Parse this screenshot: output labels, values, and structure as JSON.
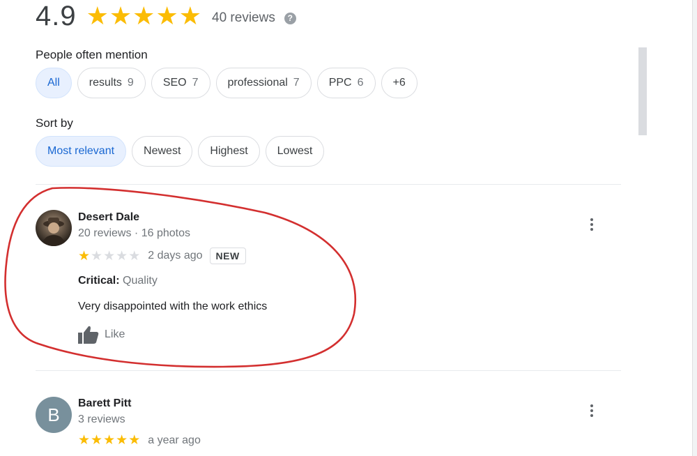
{
  "summary": {
    "rating": "4.9",
    "stars": 5,
    "review_count": "40 reviews",
    "help_icon": "question-mark-icon"
  },
  "mentions": {
    "label": "People often mention",
    "chips": [
      {
        "label": "All",
        "count": "",
        "selected": true
      },
      {
        "label": "results",
        "count": "9",
        "selected": false
      },
      {
        "label": "SEO",
        "count": "7",
        "selected": false
      },
      {
        "label": "professional",
        "count": "7",
        "selected": false
      },
      {
        "label": "PPC",
        "count": "6",
        "selected": false
      },
      {
        "label": "+6",
        "count": "",
        "selected": false
      }
    ]
  },
  "sort": {
    "label": "Sort by",
    "options": [
      {
        "label": "Most relevant",
        "selected": true
      },
      {
        "label": "Newest",
        "selected": false
      },
      {
        "label": "Highest",
        "selected": false
      },
      {
        "label": "Lowest",
        "selected": false
      }
    ]
  },
  "reviews": [
    {
      "name": "Desert Dale",
      "meta": "20 reviews · 16 photos",
      "rating": 1,
      "time": "2 days ago",
      "badge": "NEW",
      "critical_label": "Critical:",
      "critical_value": "Quality",
      "text": "Very disappointed with the work ethics",
      "like_label": "Like",
      "avatar": "photo"
    },
    {
      "name": "Barett Pitt",
      "meta": "3 reviews",
      "rating": 5,
      "time": "a year ago",
      "avatar_letter": "B"
    }
  ],
  "colors": {
    "star": "#fbbc04",
    "selected_chip_bg": "#e8f0fe",
    "selected_chip_text": "#1967d2",
    "annotation": "#d32f2f"
  }
}
